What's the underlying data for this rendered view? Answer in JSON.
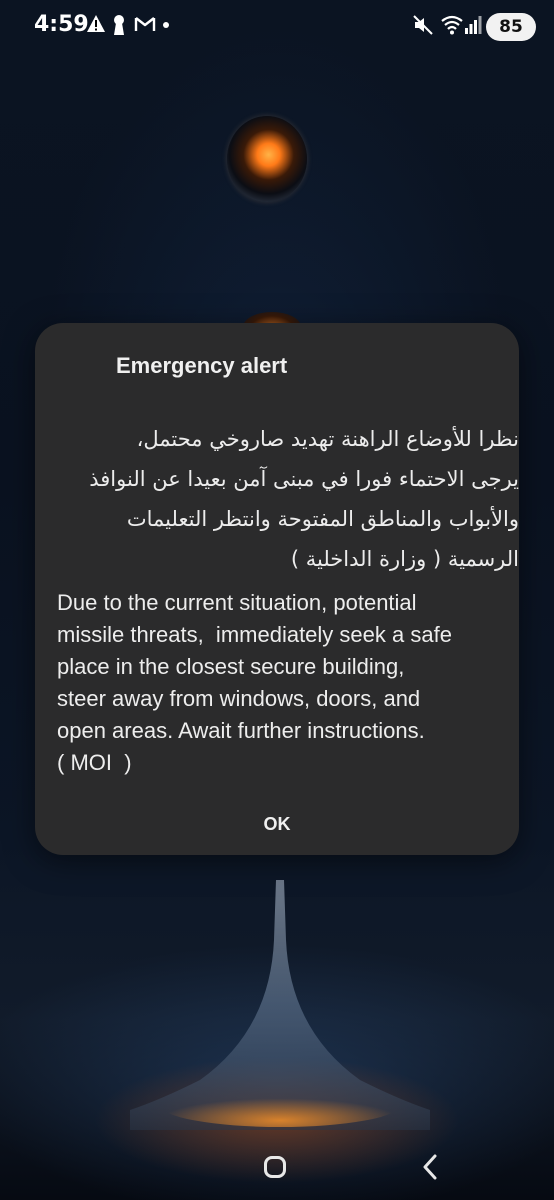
{
  "status_bar": {
    "time": "4:59",
    "battery": "85",
    "left_icons": [
      "warning-icon",
      "keyhole-icon",
      "gmail-icon",
      "dot-icon"
    ],
    "right_icons": [
      "mute-icon",
      "wifi-icon",
      "signal-icon",
      "battery-icon"
    ]
  },
  "alert": {
    "title": "Emergency alert",
    "arabic_lines": [
      "نظرا للأوضاع الراهنة تهديد صاروخي محتمل،",
      "يرجى الاحتماء فورا في مبنى آمن بعيدا عن النوافذ",
      "والأبواب والمناطق المفتوحة وانتظر التعليمات",
      "الرسمية ( وزارة الداخلية )"
    ],
    "english_lines": [
      "Due to the current situation, potential",
      "missile threats,  immediately seek a safe",
      "place in the closest secure building,",
      "steer away from windows, doors, and",
      "open areas. Await further instructions.",
      "( MOI  )"
    ],
    "ok_label": "OK"
  },
  "nav_bar": {
    "icons": [
      "home-icon",
      "back-icon"
    ]
  },
  "colors": {
    "dialog_bg": "#2b2b2c",
    "text": "#ededed",
    "wallpaper_dark": "#0a1220",
    "accent_orange": "#ff7a18"
  }
}
